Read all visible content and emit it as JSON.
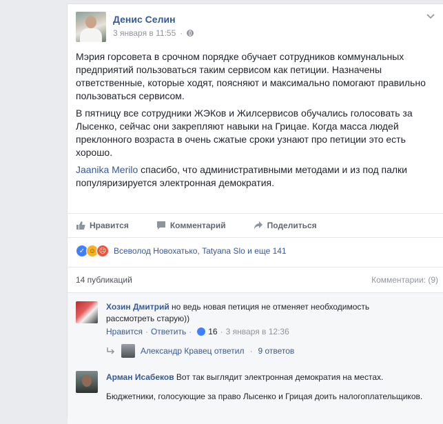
{
  "post": {
    "author": "Денис Селин",
    "date": "3 января в 11:55",
    "paragraphs": [
      "Мэрия горсовета в срочном порядке обучает сотрудников коммунальных предприятий пользоваться таким сервисом как петиции. Назначены ответственные, которые ходят, поясняют и максимально помогают правильно пользоваться сервисом.",
      "В пятницу все сотрудники ЖЭКов и Жилсервисов обучались голосовать за Лысенко, сейчас они закрепляют навыки на Грицае. Когда масса людей преклонного возраста в очень сжатые сроки узнают про петиции это есть хорошо."
    ],
    "mention": "Jaanika Merilo",
    "mention_text": " спасибо, что административными методами и из под палки популяризируется электронная демократия."
  },
  "actions": {
    "like": "Нравится",
    "comment": "Комментарий",
    "share": "Поделиться"
  },
  "reactions": {
    "names": "Всеволод Новохатько, Tatyana Slo и еще 141"
  },
  "stats": {
    "shares": "14 публикаций",
    "comments": "Комментарии: (9)"
  },
  "comments": [
    {
      "author": "Хозин Дмитрий",
      "text": " но ведь новая петиция не отменяет необходимость рассмотреть старую))",
      "like": "Нравится",
      "reply": "Ответить",
      "likes": "16",
      "date": "3 января в 12:36",
      "reply_author": "Александр Кравец ответил",
      "reply_count": "9 ответов"
    },
    {
      "author": "Арман Исабеков",
      "text": " Вот так выглядит электронная демократия на местах.",
      "text2": "Бюджетники, голосующие за право Лысенко и Грицая доить налогоплательщиков."
    }
  ],
  "separator": "·",
  "colors": {
    "link": "#365899",
    "meta": "#90949c",
    "background": "#e9ebee"
  }
}
